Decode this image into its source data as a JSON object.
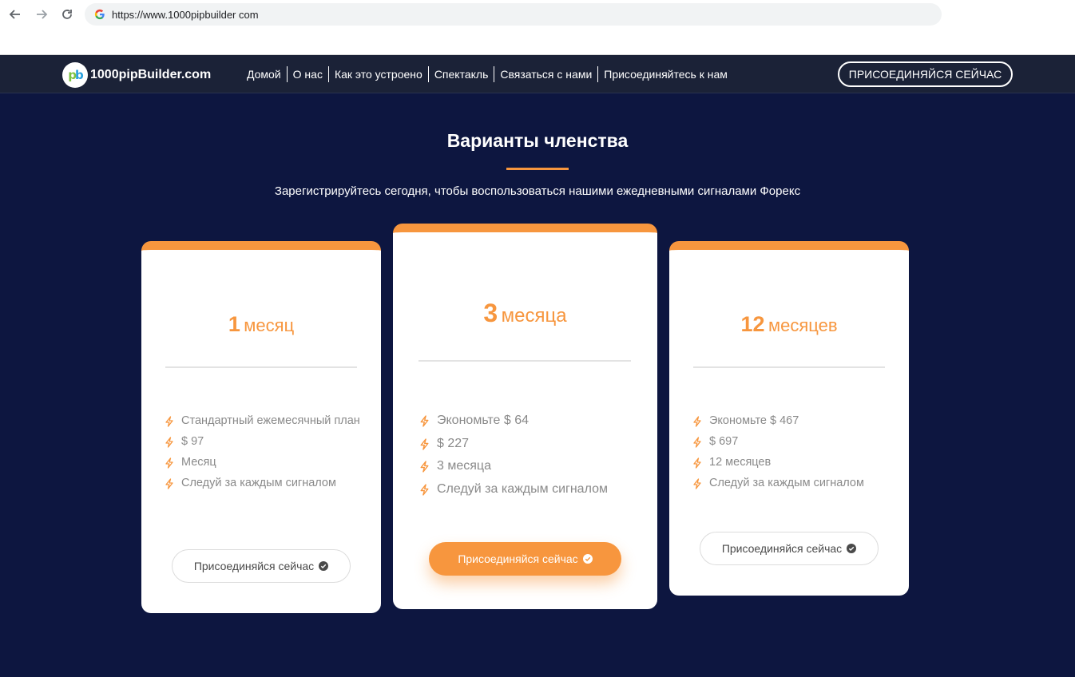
{
  "browser": {
    "url": "https://www.1000pipbuilder com"
  },
  "site": {
    "logo_text": "1000pipBuilder.com",
    "logo_mark_p": "p",
    "logo_mark_b": "b",
    "menu": [
      {
        "label": "Домой"
      },
      {
        "label": "О нас"
      },
      {
        "label": "Как это устроено"
      },
      {
        "label": "Спектакль"
      },
      {
        "label": "Связаться с нами"
      },
      {
        "label": "Присоединяйтесь к нам"
      }
    ],
    "join_top_label": "ПРИСОЕДИНЯЙСЯ СЕЙЧАС"
  },
  "section": {
    "title": "Варианты членства",
    "subtitle": "Зарегистрируйтесь сегодня, чтобы воспользоваться нашими ежедневными сигналами Форекс"
  },
  "plans": [
    {
      "num": "1",
      "unit": "месяц",
      "features": [
        "Стандартный ежемесячный план",
        "$ 97",
        "Месяц",
        "Следуй за каждым сигналом"
      ],
      "button_label": "Присоединяйся сейчас"
    },
    {
      "num": "3",
      "unit": "месяца",
      "features": [
        "Экономьте $ 64",
        "$ 227",
        "3 месяца",
        "Следуй за каждым сигналом"
      ],
      "button_label": "Присоединяйся сейчас"
    },
    {
      "num": "12",
      "unit": "месяцев",
      "features": [
        "Экономьте $ 467",
        "$ 697",
        "12 месяцев",
        "Следуй за каждым сигналом"
      ],
      "button_label": "Присоединяйся сейчас"
    }
  ],
  "colors": {
    "page_bg": "#0d1640",
    "header_bg": "#1b2237",
    "accent": "#f7963e",
    "feature_text": "#8a8a8a"
  },
  "icons": {
    "back": "arrow-left-icon",
    "forward": "arrow-right-icon",
    "reload": "reload-icon",
    "site_info": "google-icon",
    "feature": "lightning-icon",
    "button": "check-circle-icon"
  }
}
